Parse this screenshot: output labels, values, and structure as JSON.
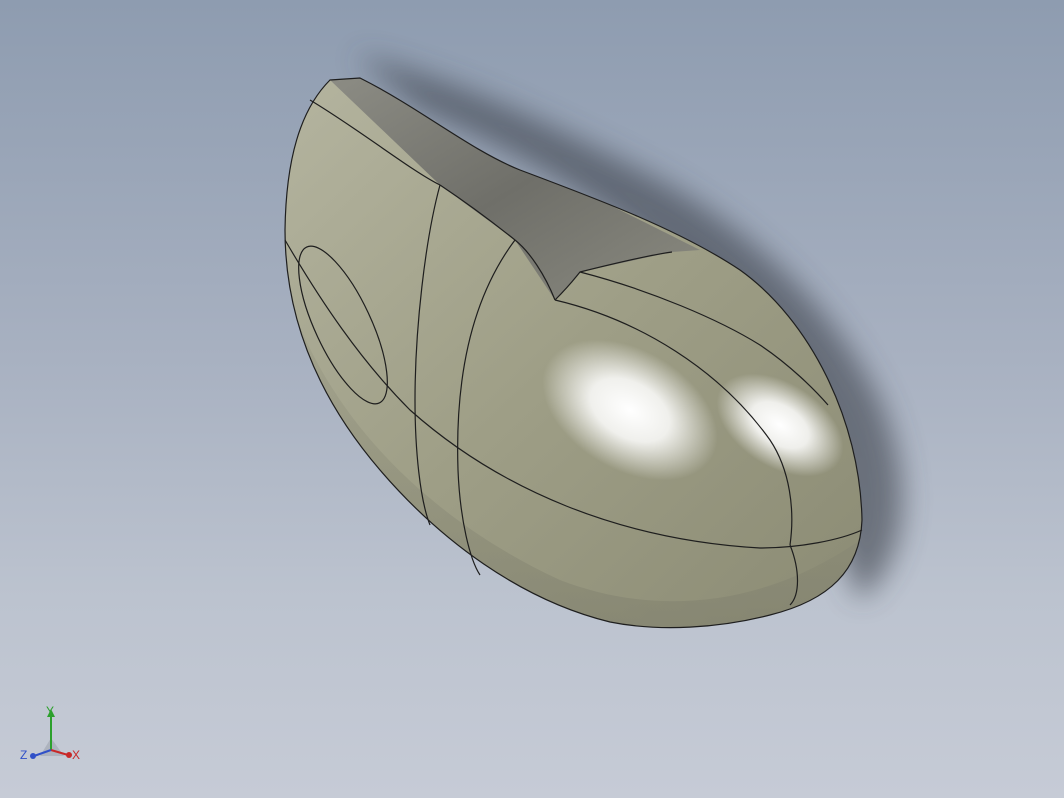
{
  "viewport": {
    "background_top": "#8e9cb0",
    "background_bottom": "#c6cbd6"
  },
  "model": {
    "face_color": "#a9a992",
    "edge_color": "#1e1e1e",
    "highlight_color": "#ffffff"
  },
  "triad": {
    "x_label": "X",
    "y_label": "Y",
    "z_label": "Z",
    "x_color": "#c82828",
    "y_color": "#2ca02c",
    "z_color": "#3050c8"
  }
}
